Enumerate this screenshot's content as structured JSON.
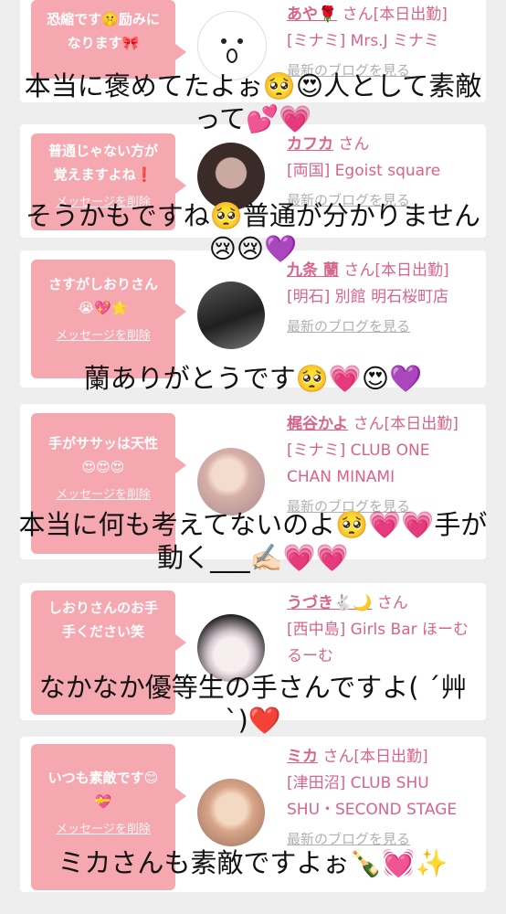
{
  "cards": [
    {
      "message": "恐縮です🤫励みに\nなります🎀",
      "delete_label": "",
      "name": "あや🌹",
      "suffix": "さん[本日出勤]",
      "shop": "[ミナミ] Mrs.J ミナミ",
      "blog_label": "最新のブログを見る",
      "avatar": "face-doodle",
      "avatar_colors": [
        "#ffffff",
        "#cccccc"
      ]
    },
    {
      "message": "普通じゃない方が\n覚えますよね❗",
      "delete_label": "メッセージを削除",
      "name": "カフカ",
      "suffix": "さん",
      "shop": "[両国] Egoist square",
      "blog_label": "最新のブログを見る",
      "avatar": "portrait-dark-hair",
      "avatar_colors": [
        "#3a2a28",
        "#c9a9a0"
      ]
    },
    {
      "message": "さすがしおりさん\n😭💖🌟",
      "delete_label": "メッセージを削除",
      "name": "九条 蘭",
      "suffix": "さん[本日出勤]",
      "shop": "[明石] 別館 明石桜町店",
      "blog_label": "最新のブログを見る",
      "avatar": "portrait-dark-dress",
      "avatar_colors": [
        "#222222",
        "#555555"
      ]
    },
    {
      "message": "手がササッは天性\n😍😍😍",
      "delete_label": "メッセージを削除",
      "name": "梶谷かよ",
      "suffix": "さん[本日出勤]",
      "shop": "[ミナミ] CLUB ONE CHAN MINAMI",
      "blog_label": "最新のブログを見る",
      "avatar": "portrait-blonde",
      "avatar_colors": [
        "#e9c8b8",
        "#b99aa0"
      ]
    },
    {
      "message": "しおりさんのお手\n手ください笑",
      "delete_label": "",
      "name": "うづき🐇🌙",
      "suffix": "さん",
      "shop": "[西中島] Girls Bar ほーむるーむ",
      "blog_label": "",
      "avatar": "portrait-sparkle",
      "avatar_colors": [
        "#f2e6ea",
        "#222222"
      ]
    },
    {
      "message": "いつも素敵です😊\n💝",
      "delete_label": "メッセージを削除",
      "name": "ミカ",
      "suffix": "さん[本日出勤]",
      "shop": "[津田沼] CLUB SHU SHU・SECOND STAGE",
      "blog_label": "最新のブログを見る",
      "avatar": "portrait-light-hair",
      "avatar_colors": [
        "#e8c4a8",
        "#c8907a"
      ]
    }
  ],
  "overlays": [
    "本当に褒めてたよぉ🥺😍人として素敵\nって💕💗",
    "そうかもですね🥺普通が分かりません\n😢😢💜",
    "蘭ありがとうです🥺💗😍💜",
    "本当に何も考えてないのよ🥺💗💗手が\n動く___✍🏻💗💗",
    "なかなか優等生の手さんですよ( ´艸\n`)❤️",
    "ミカさんも素敵ですよぉ🍾💓✨"
  ]
}
